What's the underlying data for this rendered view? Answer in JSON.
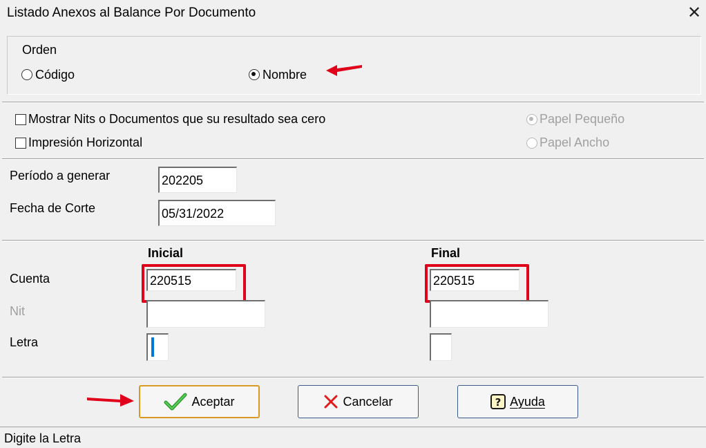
{
  "window": {
    "title": "Listado Anexos al Balance Por Documento",
    "close_glyph": "✕"
  },
  "orden": {
    "legend": "Orden",
    "options": [
      {
        "label": "Código",
        "selected": false
      },
      {
        "label": "Nombre",
        "selected": true
      }
    ]
  },
  "options": {
    "checkboxes": [
      {
        "label": "Mostrar Nits o Documentos que su resultado sea cero",
        "checked": false
      },
      {
        "label": "Impresión Horizontal",
        "checked": false
      }
    ],
    "paper": [
      {
        "label": "Papel Pequeño",
        "selected": true,
        "enabled": false
      },
      {
        "label": "Papel Ancho",
        "selected": false,
        "enabled": false
      }
    ]
  },
  "periodo": {
    "label": "Período a generar",
    "value": "202205",
    "fecha_label": "Fecha de Corte",
    "fecha_value": "05/31/2022"
  },
  "ranges": {
    "inicial_header": "Inicial",
    "final_header": "Final",
    "rows": [
      {
        "label": "Cuenta",
        "inicial": "220515",
        "final": "220515",
        "enabled": true
      },
      {
        "label": "Nit",
        "inicial": "",
        "final": "",
        "enabled": false
      },
      {
        "label": "Letra",
        "inicial": "",
        "final": "",
        "enabled": true
      }
    ]
  },
  "buttons": {
    "aceptar": "Aceptar",
    "cancelar": "Cancelar",
    "ayuda": "Ayuda"
  },
  "status": {
    "text": "Digite la Letra"
  },
  "colors": {
    "annotation_red": "#e0001a",
    "focus_border": "#d89a24",
    "button_border": "#3a5a86"
  }
}
